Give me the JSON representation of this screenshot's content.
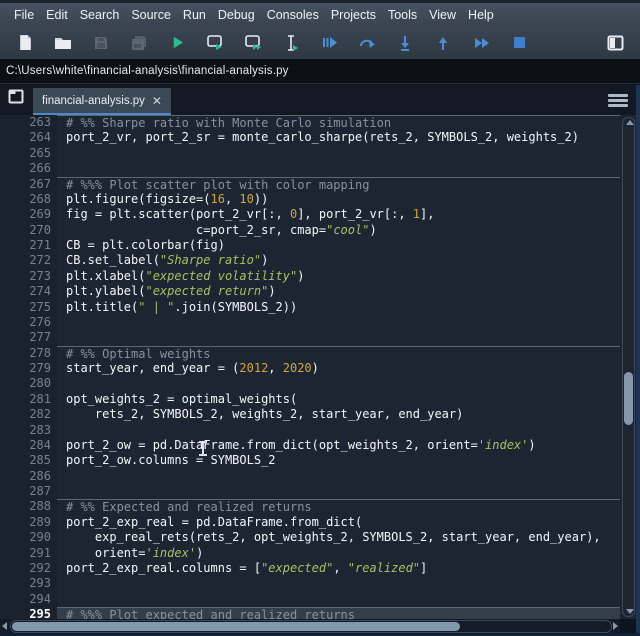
{
  "menu_bar": {
    "items": [
      "File",
      "Edit",
      "Search",
      "Source",
      "Run",
      "Debug",
      "Consoles",
      "Projects",
      "Tools",
      "View",
      "Help"
    ]
  },
  "toolbar": {
    "buttons": [
      {
        "name": "new-file",
        "enabled": true
      },
      {
        "name": "open-file",
        "enabled": true
      },
      {
        "name": "save-file",
        "enabled": false
      },
      {
        "name": "save-all",
        "enabled": false
      },
      {
        "name": "run-file",
        "enabled": true
      },
      {
        "name": "run-cell",
        "enabled": true
      },
      {
        "name": "run-cell-and-advance",
        "enabled": true
      },
      {
        "name": "run-selection",
        "enabled": true
      },
      {
        "name": "debug-file",
        "enabled": true
      },
      {
        "name": "debug-step-over",
        "enabled": true
      },
      {
        "name": "debug-step-into",
        "enabled": true
      },
      {
        "name": "debug-step-return",
        "enabled": true
      },
      {
        "name": "debug-continue",
        "enabled": true
      },
      {
        "name": "debug-stop",
        "enabled": true
      },
      {
        "name": "maximize-pane",
        "enabled": true
      }
    ]
  },
  "path_bar": {
    "path": "C:\\Users\\white\\financial-analysis\\financial-analysis.py"
  },
  "tab_bar": {
    "icons": [
      "browse-tabs-icon",
      "options-menu-icon"
    ],
    "active_tab": {
      "label": "financial-analysis.py",
      "close_glyph": "✕"
    }
  },
  "editor": {
    "current_line": 295,
    "first_line": 263,
    "last_line": 295,
    "lines": [
      {
        "n": 263,
        "sep": true,
        "tokens": [
          [
            "comment",
            "# %% Sharpe ratio with Monte Carlo simulation"
          ]
        ]
      },
      {
        "n": 264,
        "tokens": [
          [
            "code",
            "port_2_vr, port_2_sr = monte_carlo_sharpe(rets_2, SYMBOLS_2, weights_2)"
          ]
        ]
      },
      {
        "n": 265,
        "tokens": []
      },
      {
        "n": 266,
        "tokens": []
      },
      {
        "n": 267,
        "sep": true,
        "tokens": [
          [
            "comment",
            "# %%% Plot scatter plot with color mapping"
          ]
        ]
      },
      {
        "n": 268,
        "tokens": [
          [
            "code",
            "plt.figure(figsize=("
          ],
          [
            "number",
            "16"
          ],
          [
            "code",
            ", "
          ],
          [
            "number",
            "10"
          ],
          [
            "code",
            "))"
          ]
        ]
      },
      {
        "n": 269,
        "tokens": [
          [
            "code",
            "fig = plt.scatter(port_2_vr[:, "
          ],
          [
            "number",
            "0"
          ],
          [
            "code",
            "], port_2_vr[:, "
          ],
          [
            "number",
            "1"
          ],
          [
            "code",
            "],"
          ]
        ]
      },
      {
        "n": 270,
        "tokens": [
          [
            "code",
            "                  c=port_2_sr, cmap="
          ],
          [
            "string",
            "\"cool\""
          ],
          [
            "code",
            ")"
          ]
        ]
      },
      {
        "n": 271,
        "tokens": [
          [
            "code",
            "CB = plt.colorbar(fig)"
          ]
        ]
      },
      {
        "n": 272,
        "tokens": [
          [
            "code",
            "CB.set_label("
          ],
          [
            "string",
            "\"Sharpe ratio\""
          ],
          [
            "code",
            ")"
          ]
        ]
      },
      {
        "n": 273,
        "tokens": [
          [
            "code",
            "plt.xlabel("
          ],
          [
            "string",
            "\"expected volatility\""
          ],
          [
            "code",
            ")"
          ]
        ]
      },
      {
        "n": 274,
        "tokens": [
          [
            "code",
            "plt.ylabel("
          ],
          [
            "string",
            "\"expected return\""
          ],
          [
            "code",
            ")"
          ]
        ]
      },
      {
        "n": 275,
        "tokens": [
          [
            "code",
            "plt.title("
          ],
          [
            "string",
            "\" | \""
          ],
          [
            "code",
            ".join(SYMBOLS_2))"
          ]
        ]
      },
      {
        "n": 276,
        "tokens": []
      },
      {
        "n": 277,
        "tokens": []
      },
      {
        "n": 278,
        "sep": true,
        "tokens": [
          [
            "comment",
            "# %% Optimal weights"
          ]
        ]
      },
      {
        "n": 279,
        "tokens": [
          [
            "code",
            "start_year, end_year = ("
          ],
          [
            "number",
            "2012"
          ],
          [
            "code",
            ", "
          ],
          [
            "number",
            "2020"
          ],
          [
            "code",
            ")"
          ]
        ]
      },
      {
        "n": 280,
        "tokens": []
      },
      {
        "n": 281,
        "tokens": [
          [
            "code",
            "opt_weights_2 = optimal_weights("
          ]
        ]
      },
      {
        "n": 282,
        "tokens": [
          [
            "code",
            "    rets_2, SYMBOLS_2, weights_2, start_year, end_year)"
          ]
        ]
      },
      {
        "n": 283,
        "tokens": []
      },
      {
        "n": 284,
        "tokens": [
          [
            "code",
            "port_2_ow = pd.DataFrame.from_dict(opt_weights_2, orient="
          ],
          [
            "string",
            "'index'"
          ],
          [
            "code",
            ")"
          ]
        ]
      },
      {
        "n": 285,
        "tokens": [
          [
            "code",
            "port_2_ow.columns = SYMBOLS_2"
          ]
        ]
      },
      {
        "n": 286,
        "tokens": []
      },
      {
        "n": 287,
        "tokens": []
      },
      {
        "n": 288,
        "sep": true,
        "tokens": [
          [
            "comment",
            "# %% Expected and realized returns"
          ]
        ]
      },
      {
        "n": 289,
        "tokens": [
          [
            "code",
            "port_2_exp_real = pd.DataFrame.from_dict("
          ]
        ]
      },
      {
        "n": 290,
        "tokens": [
          [
            "code",
            "    exp_real_rets(rets_2, opt_weights_2, SYMBOLS_2, start_year, end_year),"
          ]
        ]
      },
      {
        "n": 291,
        "tokens": [
          [
            "code",
            "    orient="
          ],
          [
            "string",
            "'index'"
          ],
          [
            "code",
            ")"
          ]
        ]
      },
      {
        "n": 292,
        "tokens": [
          [
            "code",
            "port_2_exp_real.columns = ["
          ],
          [
            "string",
            "\"expected\""
          ],
          [
            "code",
            ", "
          ],
          [
            "string",
            "\"realized\""
          ],
          [
            "code",
            "]"
          ]
        ]
      },
      {
        "n": 293,
        "tokens": []
      },
      {
        "n": 294,
        "tokens": []
      },
      {
        "n": 295,
        "sep": true,
        "tokens": [
          [
            "comment",
            "# %%% Plot expected and realized returns"
          ]
        ]
      }
    ]
  },
  "colors": {
    "editor_background": "#1c2531",
    "comment": "#8793a0",
    "string": "#a5c261",
    "number": "#d2a53e",
    "code_text": "#f4f7fa",
    "current_line_bg": "#333e4b",
    "tab_underline": "#4e88c8",
    "run_green": "#2fbe8f",
    "debug_blue": "#4a8fd4",
    "menubar_bg": "#39434f"
  }
}
